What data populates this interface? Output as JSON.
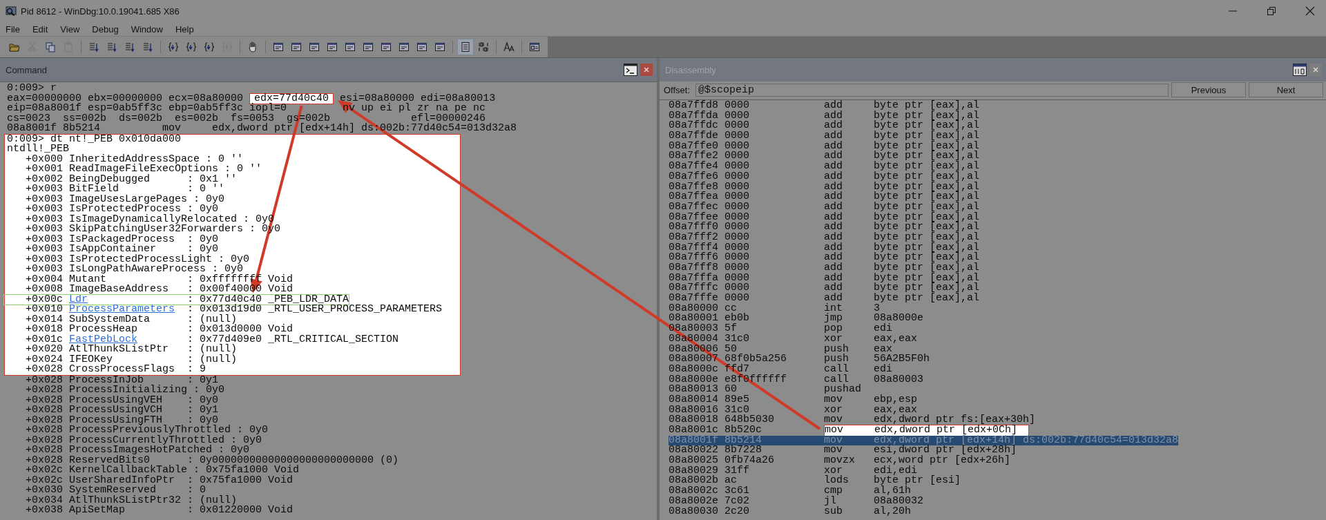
{
  "window": {
    "title": "Pid 8612 - WinDbg:10.0.19041.685 X86"
  },
  "menu": [
    "File",
    "Edit",
    "View",
    "Debug",
    "Window",
    "Help"
  ],
  "toolbar": [
    [
      {
        "kind": "folder",
        "disabled": false,
        "pressed": false
      },
      {
        "kind": "scissors",
        "disabled": true,
        "pressed": false
      },
      {
        "kind": "copy",
        "disabled": false,
        "pressed": false
      },
      {
        "kind": "clipboard",
        "disabled": true,
        "pressed": false
      }
    ],
    [
      {
        "kind": "step",
        "disabled": false,
        "pressed": false
      },
      {
        "kind": "step",
        "disabled": false,
        "pressed": false
      },
      {
        "kind": "step",
        "disabled": false,
        "pressed": false
      },
      {
        "kind": "step",
        "disabled": false,
        "pressed": false
      }
    ],
    [
      {
        "kind": "braces",
        "disabled": false,
        "pressed": false
      },
      {
        "kind": "braces",
        "disabled": false,
        "pressed": false
      },
      {
        "kind": "braces",
        "disabled": false,
        "pressed": false
      },
      {
        "kind": "braces",
        "disabled": true,
        "pressed": false
      }
    ],
    [
      {
        "kind": "hand",
        "disabled": false,
        "pressed": false
      }
    ],
    [
      {
        "kind": "window",
        "disabled": false,
        "pressed": false
      },
      {
        "kind": "window",
        "disabled": false,
        "pressed": false
      },
      {
        "kind": "window",
        "disabled": false,
        "pressed": false
      },
      {
        "kind": "window",
        "disabled": false,
        "pressed": false
      },
      {
        "kind": "window",
        "disabled": false,
        "pressed": false
      },
      {
        "kind": "window",
        "disabled": false,
        "pressed": false
      },
      {
        "kind": "window",
        "disabled": false,
        "pressed": false
      },
      {
        "kind": "window",
        "disabled": false,
        "pressed": false
      },
      {
        "kind": "window",
        "disabled": false,
        "pressed": false
      },
      {
        "kind": "window",
        "disabled": false,
        "pressed": false
      }
    ],
    [
      {
        "kind": "lines",
        "disabled": false,
        "pressed": true
      },
      {
        "kind": "binary",
        "disabled": false,
        "pressed": false
      }
    ],
    [
      {
        "kind": "font",
        "disabled": false,
        "pressed": false
      }
    ],
    [
      {
        "kind": "dialog",
        "disabled": false,
        "pressed": false
      }
    ]
  ],
  "command": {
    "title": "Command",
    "blocks": [
      {
        "spotlight": false,
        "lines": [
          {
            "kind": "text",
            "segments": [
              {
                "text": "0:009> r",
                "callout": false
              }
            ]
          },
          {
            "kind": "text",
            "segments": [
              {
                "text": "eax=00000000 ebx=00000000 ecx=08a80000 ",
                "callout": false
              },
              {
                "text": "edx=77d40c40",
                "callout": true
              },
              {
                "text": " esi=08a80000 edi=08a80013",
                "callout": false
              }
            ]
          },
          {
            "kind": "text",
            "segments": [
              {
                "text": "eip=08a8001f esp=0ab5ff3c ebp=0ab5ff3c iopl=0         nv up ei pl zr na pe nc",
                "callout": false
              }
            ]
          },
          {
            "kind": "text",
            "segments": [
              {
                "text": "cs=0023  ss=002b  ds=002b  es=002b  fs=0053  gs=002b             efl=00000246",
                "callout": false
              }
            ]
          },
          {
            "kind": "text",
            "segments": [
              {
                "text": "08a8001f 8b5214          mov     edx,dword ptr [edx+14h] ds:002b:77d40c54=013d32a8",
                "callout": false
              }
            ]
          }
        ]
      },
      {
        "spotlight": true,
        "lines": [
          {
            "kind": "text",
            "segments": [
              {
                "text": "0:009> dt nt!_PEB 0x010da000",
                "callout": false
              }
            ]
          },
          {
            "kind": "text",
            "segments": [
              {
                "text": "ntdll!_PEB",
                "callout": false
              }
            ]
          },
          {
            "kind": "member",
            "offset": "+0x000",
            "name": "InheritedAddressSpace",
            "link": false,
            "value": ": 0 ''",
            "boxed": false
          },
          {
            "kind": "member",
            "offset": "+0x001",
            "name": "ReadImageFileExecOptions",
            "link": false,
            "value": ": 0 ''",
            "boxed": false
          },
          {
            "kind": "member",
            "offset": "+0x002",
            "name": "BeingDebugged",
            "link": false,
            "value": ": 0x1 ''",
            "boxed": false
          },
          {
            "kind": "member",
            "offset": "+0x003",
            "name": "BitField",
            "link": false,
            "value": ": 0 ''",
            "boxed": false
          },
          {
            "kind": "member",
            "offset": "+0x003",
            "name": "ImageUsesLargePages",
            "link": false,
            "value": ": 0y0",
            "boxed": false
          },
          {
            "kind": "member",
            "offset": "+0x003",
            "name": "IsProtectedProcess",
            "link": false,
            "value": ": 0y0",
            "boxed": false
          },
          {
            "kind": "member",
            "offset": "+0x003",
            "name": "IsImageDynamicallyRelocated",
            "link": false,
            "value": ": 0y0",
            "boxed": false
          },
          {
            "kind": "member",
            "offset": "+0x003",
            "name": "SkipPatchingUser32Forwarders",
            "link": false,
            "value": ": 0y0",
            "boxed": false
          },
          {
            "kind": "member",
            "offset": "+0x003",
            "name": "IsPackagedProcess",
            "link": false,
            "value": ": 0y0",
            "boxed": false
          },
          {
            "kind": "member",
            "offset": "+0x003",
            "name": "IsAppContainer",
            "link": false,
            "value": ": 0y0",
            "boxed": false
          },
          {
            "kind": "member",
            "offset": "+0x003",
            "name": "IsProtectedProcessLight",
            "link": false,
            "value": ": 0y0",
            "boxed": false
          },
          {
            "kind": "member",
            "offset": "+0x003",
            "name": "IsLongPathAwareProcess",
            "link": false,
            "value": ": 0y0",
            "boxed": false
          },
          {
            "kind": "member",
            "offset": "+0x004",
            "name": "Mutant",
            "link": false,
            "value": ": 0xffffffff Void",
            "boxed": false
          },
          {
            "kind": "member",
            "offset": "+0x008",
            "name": "ImageBaseAddress",
            "link": false,
            "value": ": 0x00f40000 Void",
            "boxed": false
          },
          {
            "kind": "member",
            "offset": "+0x00c",
            "name": "Ldr",
            "link": true,
            "value": ": 0x77d40c40 _PEB_LDR_DATA",
            "boxed": true
          },
          {
            "kind": "member",
            "offset": "+0x010",
            "name": "ProcessParameters",
            "link": true,
            "value": ": 0x013d19d0 _RTL_USER_PROCESS_PARAMETERS",
            "boxed": false
          },
          {
            "kind": "member",
            "offset": "+0x014",
            "name": "SubSystemData",
            "link": false,
            "value": ": (null)",
            "boxed": false
          },
          {
            "kind": "member",
            "offset": "+0x018",
            "name": "ProcessHeap",
            "link": false,
            "value": ": 0x013d0000 Void",
            "boxed": false
          },
          {
            "kind": "member",
            "offset": "+0x01c",
            "name": "FastPebLock",
            "link": true,
            "value": ": 0x77d409e0 _RTL_CRITICAL_SECTION",
            "boxed": false
          },
          {
            "kind": "member",
            "offset": "+0x020",
            "name": "AtlThunkSListPtr",
            "link": false,
            "value": ": (null)",
            "boxed": false
          },
          {
            "kind": "member",
            "offset": "+0x024",
            "name": "IFEOKey",
            "link": false,
            "value": ": (null)",
            "boxed": false
          },
          {
            "kind": "member",
            "offset": "+0x028",
            "name": "CrossProcessFlags",
            "link": false,
            "value": ": 9",
            "boxed": false
          }
        ]
      },
      {
        "spotlight": false,
        "lines": [
          {
            "kind": "member",
            "offset": "+0x028",
            "name": "ProcessInJob",
            "link": false,
            "value": ": 0y1",
            "boxed": false
          },
          {
            "kind": "member",
            "offset": "+0x028",
            "name": "ProcessInitializing",
            "link": false,
            "value": ": 0y0",
            "boxed": false
          },
          {
            "kind": "member",
            "offset": "+0x028",
            "name": "ProcessUsingVEH",
            "link": false,
            "value": ": 0y0",
            "boxed": false
          },
          {
            "kind": "member",
            "offset": "+0x028",
            "name": "ProcessUsingVCH",
            "link": false,
            "value": ": 0y1",
            "boxed": false
          },
          {
            "kind": "member",
            "offset": "+0x028",
            "name": "ProcessUsingFTH",
            "link": false,
            "value": ": 0y0",
            "boxed": false
          },
          {
            "kind": "member",
            "offset": "+0x028",
            "name": "ProcessPreviouslyThrottled",
            "link": false,
            "value": ": 0y0",
            "boxed": false
          },
          {
            "kind": "member",
            "offset": "+0x028",
            "name": "ProcessCurrentlyThrottled",
            "link": false,
            "value": ": 0y0",
            "boxed": false
          },
          {
            "kind": "member",
            "offset": "+0x028",
            "name": "ProcessImagesHotPatched",
            "link": false,
            "value": ": 0y0",
            "boxed": false
          },
          {
            "kind": "member",
            "offset": "+0x028",
            "name": "ReservedBits0",
            "link": false,
            "value": ": 0y00000000000000000000000000 (0)",
            "boxed": false
          },
          {
            "kind": "member",
            "offset": "+0x02c",
            "name": "KernelCallbackTable",
            "link": false,
            "value": ": 0x75fa1000 Void",
            "boxed": false
          },
          {
            "kind": "member",
            "offset": "+0x02c",
            "name": "UserSharedInfoPtr",
            "link": false,
            "value": ": 0x75fa1000 Void",
            "boxed": false
          },
          {
            "kind": "member",
            "offset": "+0x030",
            "name": "SystemReserved",
            "link": false,
            "value": ": 0",
            "boxed": false
          },
          {
            "kind": "member",
            "offset": "+0x034",
            "name": "AtlThunkSListPtr32",
            "link": false,
            "value": ": (null)",
            "boxed": false
          },
          {
            "kind": "member",
            "offset": "+0x038",
            "name": "ApiSetMap",
            "link": false,
            "value": ": 0x01220000 Void",
            "boxed": false
          }
        ]
      }
    ]
  },
  "disassembly": {
    "title": "Disassembly",
    "offset_label": "Offset:",
    "offset_value": "@$scopeip",
    "buttons": [
      "Previous",
      "Next"
    ],
    "rows": [
      {
        "address": "08a7ffd8",
        "bytes": "0000",
        "mnemonic": "add",
        "operands": "byte ptr [eax],al",
        "selected": false,
        "callout": false
      },
      {
        "address": "08a7ffda",
        "bytes": "0000",
        "mnemonic": "add",
        "operands": "byte ptr [eax],al",
        "selected": false,
        "callout": false
      },
      {
        "address": "08a7ffdc",
        "bytes": "0000",
        "mnemonic": "add",
        "operands": "byte ptr [eax],al",
        "selected": false,
        "callout": false
      },
      {
        "address": "08a7ffde",
        "bytes": "0000",
        "mnemonic": "add",
        "operands": "byte ptr [eax],al",
        "selected": false,
        "callout": false
      },
      {
        "address": "08a7ffe0",
        "bytes": "0000",
        "mnemonic": "add",
        "operands": "byte ptr [eax],al",
        "selected": false,
        "callout": false
      },
      {
        "address": "08a7ffe2",
        "bytes": "0000",
        "mnemonic": "add",
        "operands": "byte ptr [eax],al",
        "selected": false,
        "callout": false
      },
      {
        "address": "08a7ffe4",
        "bytes": "0000",
        "mnemonic": "add",
        "operands": "byte ptr [eax],al",
        "selected": false,
        "callout": false
      },
      {
        "address": "08a7ffe6",
        "bytes": "0000",
        "mnemonic": "add",
        "operands": "byte ptr [eax],al",
        "selected": false,
        "callout": false
      },
      {
        "address": "08a7ffe8",
        "bytes": "0000",
        "mnemonic": "add",
        "operands": "byte ptr [eax],al",
        "selected": false,
        "callout": false
      },
      {
        "address": "08a7ffea",
        "bytes": "0000",
        "mnemonic": "add",
        "operands": "byte ptr [eax],al",
        "selected": false,
        "callout": false
      },
      {
        "address": "08a7ffec",
        "bytes": "0000",
        "mnemonic": "add",
        "operands": "byte ptr [eax],al",
        "selected": false,
        "callout": false
      },
      {
        "address": "08a7ffee",
        "bytes": "0000",
        "mnemonic": "add",
        "operands": "byte ptr [eax],al",
        "selected": false,
        "callout": false
      },
      {
        "address": "08a7fff0",
        "bytes": "0000",
        "mnemonic": "add",
        "operands": "byte ptr [eax],al",
        "selected": false,
        "callout": false
      },
      {
        "address": "08a7fff2",
        "bytes": "0000",
        "mnemonic": "add",
        "operands": "byte ptr [eax],al",
        "selected": false,
        "callout": false
      },
      {
        "address": "08a7fff4",
        "bytes": "0000",
        "mnemonic": "add",
        "operands": "byte ptr [eax],al",
        "selected": false,
        "callout": false
      },
      {
        "address": "08a7fff6",
        "bytes": "0000",
        "mnemonic": "add",
        "operands": "byte ptr [eax],al",
        "selected": false,
        "callout": false
      },
      {
        "address": "08a7fff8",
        "bytes": "0000",
        "mnemonic": "add",
        "operands": "byte ptr [eax],al",
        "selected": false,
        "callout": false
      },
      {
        "address": "08a7fffa",
        "bytes": "0000",
        "mnemonic": "add",
        "operands": "byte ptr [eax],al",
        "selected": false,
        "callout": false
      },
      {
        "address": "08a7fffc",
        "bytes": "0000",
        "mnemonic": "add",
        "operands": "byte ptr [eax],al",
        "selected": false,
        "callout": false
      },
      {
        "address": "08a7fffe",
        "bytes": "0000",
        "mnemonic": "add",
        "operands": "byte ptr [eax],al",
        "selected": false,
        "callout": false
      },
      {
        "address": "08a80000",
        "bytes": "cc",
        "mnemonic": "int",
        "operands": "3",
        "selected": false,
        "callout": false
      },
      {
        "address": "08a80001",
        "bytes": "eb0b",
        "mnemonic": "jmp",
        "operands": "08a8000e",
        "selected": false,
        "callout": false
      },
      {
        "address": "08a80003",
        "bytes": "5f",
        "mnemonic": "pop",
        "operands": "edi",
        "selected": false,
        "callout": false
      },
      {
        "address": "08a80004",
        "bytes": "31c0",
        "mnemonic": "xor",
        "operands": "eax,eax",
        "selected": false,
        "callout": false
      },
      {
        "address": "08a80006",
        "bytes": "50",
        "mnemonic": "push",
        "operands": "eax",
        "selected": false,
        "callout": false
      },
      {
        "address": "08a80007",
        "bytes": "68f0b5a256",
        "mnemonic": "push",
        "operands": "56A2B5F0h",
        "selected": false,
        "callout": false
      },
      {
        "address": "08a8000c",
        "bytes": "ffd7",
        "mnemonic": "call",
        "operands": "edi",
        "selected": false,
        "callout": false
      },
      {
        "address": "08a8000e",
        "bytes": "e8f0ffffff",
        "mnemonic": "call",
        "operands": "08a80003",
        "selected": false,
        "callout": false
      },
      {
        "address": "08a80013",
        "bytes": "60",
        "mnemonic": "pushad",
        "operands": "",
        "selected": false,
        "callout": false
      },
      {
        "address": "08a80014",
        "bytes": "89e5",
        "mnemonic": "mov",
        "operands": "ebp,esp",
        "selected": false,
        "callout": false
      },
      {
        "address": "08a80016",
        "bytes": "31c0",
        "mnemonic": "xor",
        "operands": "eax,eax",
        "selected": false,
        "callout": false
      },
      {
        "address": "08a80018",
        "bytes": "648b5030",
        "mnemonic": "mov",
        "operands": "edx,dword ptr fs:[eax+30h]",
        "selected": false,
        "callout": false
      },
      {
        "address": "08a8001c",
        "bytes": "8b520c",
        "mnemonic": "mov",
        "operands": "edx,dword ptr [edx+0Ch]",
        "selected": false,
        "callout": true
      },
      {
        "address": "08a8001f",
        "bytes": "8b5214",
        "mnemonic": "mov",
        "operands": "edx,dword ptr [edx+14h] ds:002b:77d40c54=013d32a8",
        "selected": true,
        "callout": false
      },
      {
        "address": "08a80022",
        "bytes": "8b7228",
        "mnemonic": "mov",
        "operands": "esi,dword ptr [edx+28h]",
        "selected": false,
        "callout": false
      },
      {
        "address": "08a80025",
        "bytes": "0fb74a26",
        "mnemonic": "movzx",
        "operands": "ecx,word ptr [edx+26h]",
        "selected": false,
        "callout": false
      },
      {
        "address": "08a80029",
        "bytes": "31ff",
        "mnemonic": "xor",
        "operands": "edi,edi",
        "selected": false,
        "callout": false
      },
      {
        "address": "08a8002b",
        "bytes": "ac",
        "mnemonic": "lods",
        "operands": "byte ptr [esi]",
        "selected": false,
        "callout": false
      },
      {
        "address": "08a8002c",
        "bytes": "3c61",
        "mnemonic": "cmp",
        "operands": "al,61h",
        "selected": false,
        "callout": false
      },
      {
        "address": "08a8002e",
        "bytes": "7c02",
        "mnemonic": "jl",
        "operands": "08a80032",
        "selected": false,
        "callout": false
      },
      {
        "address": "08a80030",
        "bytes": "2c20",
        "mnemonic": "sub",
        "operands": "al,20h",
        "selected": false,
        "callout": false
      }
    ]
  }
}
